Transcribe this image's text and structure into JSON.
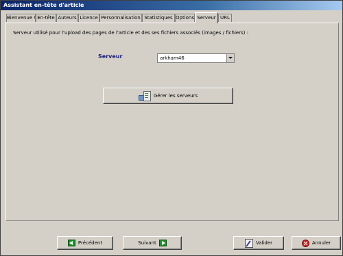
{
  "window": {
    "title": "Assistant en-tête d'article"
  },
  "tabs": [
    {
      "label": "Bienvenue !"
    },
    {
      "label": "En-tête"
    },
    {
      "label": "Auteurs"
    },
    {
      "label": "Licence"
    },
    {
      "label": "Personnalisation"
    },
    {
      "label": "Statistiques"
    },
    {
      "label": "Options"
    },
    {
      "label": "Serveur"
    },
    {
      "label": "URL"
    }
  ],
  "active_tab": "Serveur",
  "server_page": {
    "description": "Serveur utilisé pour l'upload des pages de l'article et des ses fichiers associés (images / fichiers) :",
    "server_label": "Serveur",
    "server_value": "arkham46",
    "manage_label": "Gérer les serveurs"
  },
  "footer": {
    "prev_label": "Précédent",
    "next_label": "Suivant",
    "validate_label": "Valider",
    "cancel_label": "Annuler"
  },
  "icons": {
    "manage": "server-manage-icon",
    "prev": "arrow-left-icon",
    "next": "arrow-right-icon",
    "validate": "pen-icon",
    "cancel": "cancel-icon"
  }
}
